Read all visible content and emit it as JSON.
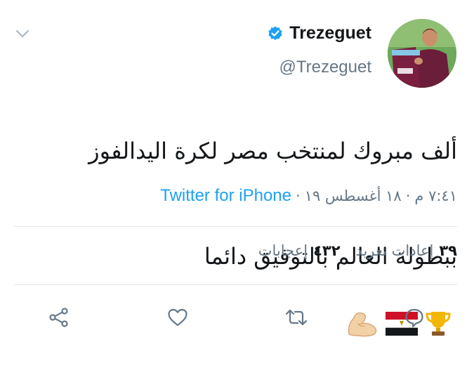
{
  "user": {
    "display_name": "Trezeguet",
    "handle": "@Trezeguet",
    "verified": true
  },
  "tweet": {
    "line1": "ألف مبروك لمنتخب مصر لكرة اليدالفوز",
    "line2": "ببطولة العالم  بالتوفيق دائما",
    "emojis": [
      "trophy",
      "egypt-flag",
      "flexed-biceps"
    ]
  },
  "meta": {
    "time": "٧:٤١ م",
    "date": "١٨ أغسطس ١٩",
    "separator": "·",
    "source": "Twitter for iPhone"
  },
  "stats": {
    "retweets_count": "٣٩",
    "retweets_label": "إعادات تغريد",
    "likes_count": "٤٣٢",
    "likes_label": "إعجابات"
  },
  "actions": [
    "reply-icon",
    "retweet-icon",
    "like-icon",
    "share-icon"
  ],
  "colors": {
    "link": "#1da1f2",
    "muted": "#657786",
    "text": "#14171a",
    "divider": "#e1e8ed"
  }
}
